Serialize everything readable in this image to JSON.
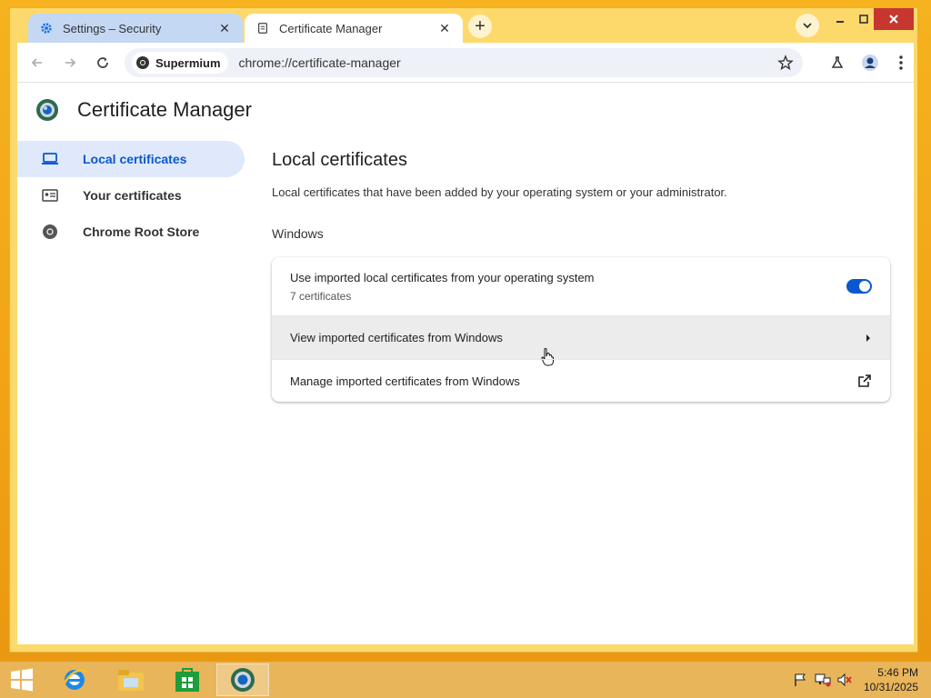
{
  "tabs": [
    {
      "title": "Settings – Security",
      "icon": "gear-icon",
      "active": false
    },
    {
      "title": "Certificate Manager",
      "icon": "document-icon",
      "active": true
    }
  ],
  "toolbar": {
    "site_chip": "Supermium",
    "url": "chrome://certificate-manager"
  },
  "page": {
    "app_title": "Certificate Manager",
    "sidebar": [
      {
        "label": "Local certificates",
        "icon": "laptop-icon",
        "active": true
      },
      {
        "label": "Your certificates",
        "icon": "id-card-icon",
        "active": false
      },
      {
        "label": "Chrome Root Store",
        "icon": "chrome-icon",
        "active": false
      }
    ],
    "section_title": "Local certificates",
    "section_desc": "Local certificates that have been added by your operating system or your administrator.",
    "group_title": "Windows",
    "rows": {
      "toggle_title": "Use imported local certificates from your operating system",
      "toggle_sub": "7 certificates",
      "toggle_on": true,
      "view_label": "View imported certificates from Windows",
      "manage_label": "Manage imported certificates from Windows"
    }
  },
  "taskbar": {
    "time": "5:46 PM",
    "date": "10/31/2025"
  },
  "colors": {
    "accent": "#0b57d0",
    "active_nav_bg": "#dfe9fb",
    "desktop": "#f2a518"
  }
}
